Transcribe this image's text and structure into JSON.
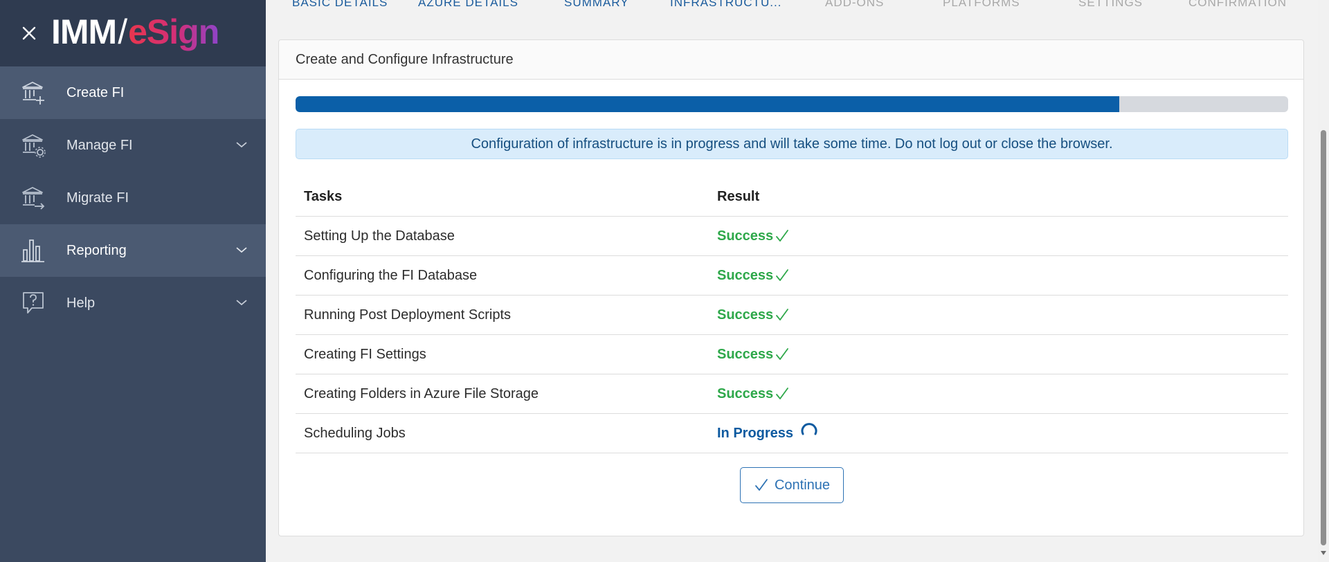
{
  "app": {
    "logo_left": "IMM",
    "logo_slash": "/",
    "logo_right": "eSign"
  },
  "sidebar": {
    "items": [
      {
        "label": "Create FI",
        "icon": "bank-plus-icon"
      },
      {
        "label": "Manage FI",
        "icon": "bank-gear-icon"
      },
      {
        "label": "Migrate FI",
        "icon": "bank-arrow-icon"
      },
      {
        "label": "Reporting",
        "icon": "bar-chart-icon"
      },
      {
        "label": "Help",
        "icon": "help-bubble-icon"
      }
    ]
  },
  "tabs": [
    {
      "label": "BASIC DETAILS",
      "state": "completed"
    },
    {
      "label": "AZURE DETAILS",
      "state": "completed"
    },
    {
      "label": "SUMMARY",
      "state": "completed"
    },
    {
      "label": "INFRASTRUCTU...",
      "state": "active"
    },
    {
      "label": "ADD-ONS",
      "state": "pending"
    },
    {
      "label": "PLATFORMS",
      "state": "pending"
    },
    {
      "label": "SETTINGS",
      "state": "pending"
    },
    {
      "label": "CONFIRMATION",
      "state": "pending"
    }
  ],
  "card": {
    "title": "Create and Configure Infrastructure",
    "progress_fraction": 0.83,
    "info_message": "Configuration of infrastructure is in progress and will take some time. Do not log out or close the browser.",
    "table": {
      "headers": [
        "Tasks",
        "Result"
      ],
      "rows": [
        {
          "task": "Setting Up the Database",
          "result": "Success",
          "status": "success"
        },
        {
          "task": "Configuring the FI Database",
          "result": "Success",
          "status": "success"
        },
        {
          "task": "Running Post Deployment Scripts",
          "result": "Success",
          "status": "success"
        },
        {
          "task": "Creating FI Settings",
          "result": "Success",
          "status": "success"
        },
        {
          "task": "Creating Folders in Azure File Storage",
          "result": "Success",
          "status": "success"
        },
        {
          "task": "Scheduling Jobs",
          "result": "In Progress",
          "status": "in-progress"
        }
      ]
    },
    "continue_label": "Continue"
  },
  "colors": {
    "sidebar_bg": "#3b4960",
    "accent_blue": "#0b5fa8",
    "success_green": "#2ea84a"
  }
}
